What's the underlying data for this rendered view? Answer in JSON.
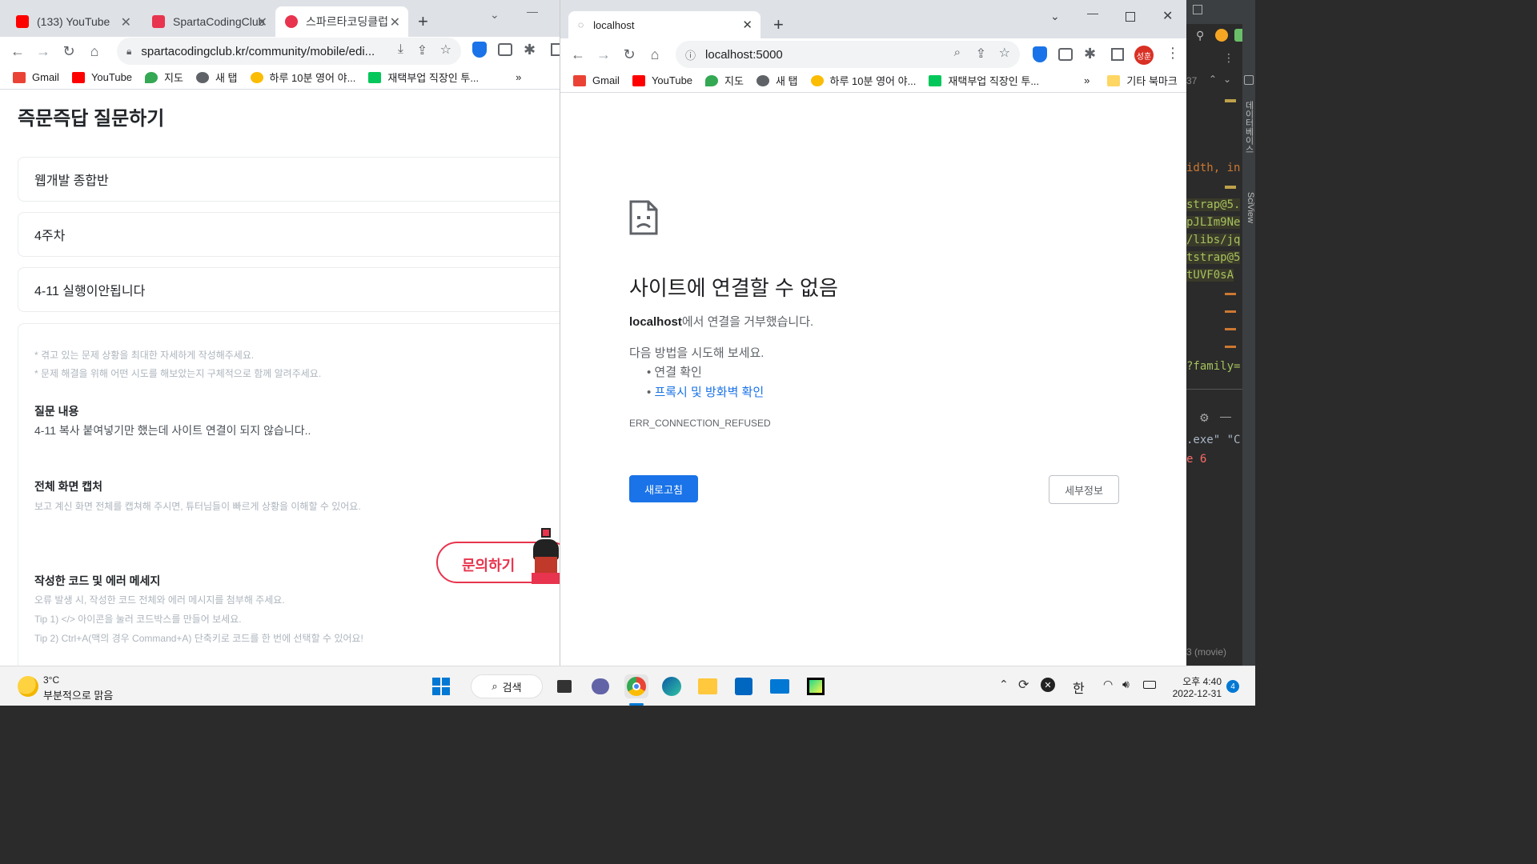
{
  "left_browser": {
    "tabs": [
      {
        "label": "(133) YouTube",
        "active": false
      },
      {
        "label": "SpartaCodingClub",
        "active": false
      },
      {
        "label": "스파르타코딩클럽",
        "active": true
      }
    ],
    "new_tab": "+",
    "url": "spartacodingclub.kr/community/mobile/edi...",
    "bookmarks": [
      "Gmail",
      "YouTube",
      "지도",
      "새 탭",
      "하루 10분 영어 야...",
      "재택부업 직장인 투..."
    ],
    "more": "»",
    "page": {
      "title": "즉문즉답 질문하기",
      "course": "웹개발 종합반",
      "week": "4주차",
      "subject": "4-11 실행이안됩니다",
      "hints": [
        "* 겪고 있는 문제 상황을 최대한 자세하게 작성해주세요.",
        "* 문제 해결을 위해 어떤 시도를 해보았는지 구체적으로 함께 알려주세요."
      ],
      "question_label": "질문 내용",
      "question_text": "4-11 복사 붙여넣기만 했는데 사이트 연결이 되지 않습니다..",
      "capture_label": "전체 화면 캡처",
      "capture_hint": "보고 계신 화면 전체를 캡쳐해 주시면, 튜터님들이 빠르게 상황을 이해할 수 있어요.",
      "code_label": "작성한 코드 및 에러 메세지",
      "code_hints": [
        "오류 발생 시, 작성한 코드 전체와 에러 메시지를 첨부해 주세요.",
        "Tip 1) </> 아이콘을 눌러 코드박스를 만들어 보세요.",
        "Tip 2) Ctrl+A(맥의 경우 Command+A) 단축키로 코드를 한 번에 선택할 수 있어요!"
      ],
      "inquiry_button": "문의하기"
    }
  },
  "right_browser": {
    "tab_label": "localhost",
    "new_tab": "+",
    "url": "localhost:5000",
    "profile": "성훈",
    "bookmarks": [
      "Gmail",
      "YouTube",
      "지도",
      "새 탭",
      "하루 10분 영어 야...",
      "재택부업 직장인 투..."
    ],
    "more": "»",
    "other_bookmarks": "기타 북마크",
    "error": {
      "title": "사이트에 연결할 수 없음",
      "host": "localhost",
      "message": "에서 연결을 거부했습니다.",
      "try_label": "다음 방법을 시도해 보세요.",
      "suggestions": [
        "연결 확인",
        "프록시 및 방화벽 확인"
      ],
      "code": "ERR_CONNECTION_REFUSED",
      "reload_button": "새로고침",
      "details_button": "세부정보"
    }
  },
  "ide": {
    "line_no": "37",
    "code_lines": [
      "idth, in",
      "strap@5.",
      "pJLIm9Ne",
      "/libs/jq",
      "tstrap@5",
      "tUVF0sA",
      "?family="
    ],
    "console_lines": [
      ".exe\" \"C",
      "e 6"
    ],
    "status": "3 (movie)",
    "side_label_1": "데이터베이스",
    "side_label_2": "SciView"
  },
  "taskbar": {
    "weather_temp": "3°C",
    "weather_desc": "부분적으로 맑음",
    "search_label": "검색",
    "ime": "한",
    "time": "오후 4:40",
    "date": "2022-12-31",
    "notifications": "4"
  },
  "colors": {
    "accent_blue": "#1a73e8",
    "sparta_red": "#e8344e",
    "error_link": "#1a73e8"
  }
}
